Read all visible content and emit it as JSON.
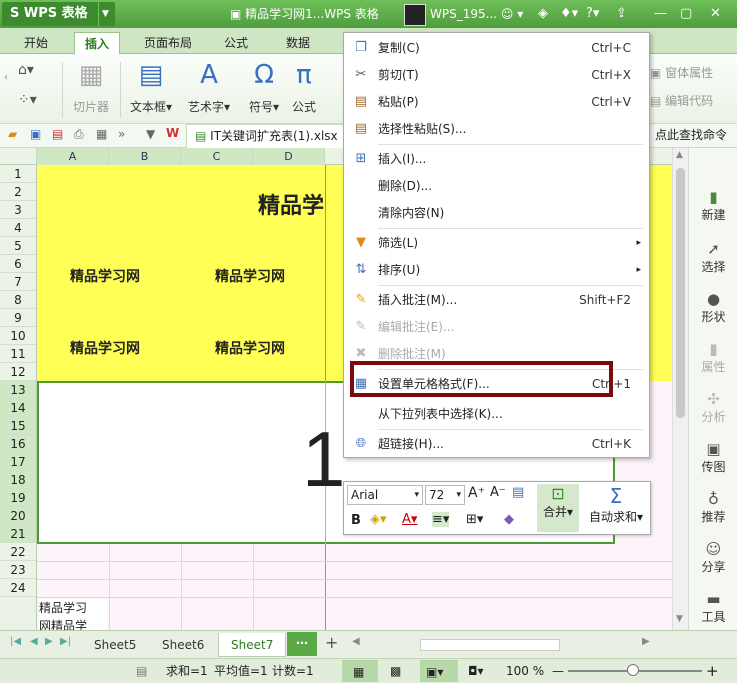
{
  "app": {
    "name": "S WPS 表格",
    "doc_title": "精品学习网1...WPS 表格",
    "user": "WPS_195..."
  },
  "tabs": [
    "开始",
    "插入",
    "页面布局",
    "公式",
    "数据"
  ],
  "active_tab": "插入",
  "ribbon": {
    "slicer": "切片器",
    "textbox": "文本框",
    "wordart": "艺术字",
    "symbol": "符号",
    "formula": "公式",
    "window_props": "窗体属性",
    "edit_code": "编辑代码"
  },
  "file_tab": "IT关键词扩充表(1).xlsx *",
  "find_command": "点此查找命令",
  "columns": [
    "A",
    "B",
    "C",
    "D"
  ],
  "rows": [
    "1",
    "2",
    "3",
    "4",
    "5",
    "6",
    "7",
    "8",
    "9",
    "10",
    "11",
    "12",
    "13",
    "14",
    "15",
    "16",
    "17",
    "18",
    "19",
    "20",
    "21",
    "22",
    "23",
    "24"
  ],
  "cells": {
    "title": "精品学",
    "c1": "精品学习网",
    "c2": "精品学习网",
    "c3": "精品学习网",
    "c4": "精品学习网",
    "big_number": "1",
    "wrap_line1": "精品学习",
    "wrap_line2": "网精品学"
  },
  "context_menu": [
    {
      "icon": "copy-icon",
      "label": "复制(C)",
      "shortcut": "Ctrl+C"
    },
    {
      "icon": "cut-icon",
      "label": "剪切(T)",
      "shortcut": "Ctrl+X"
    },
    {
      "icon": "paste-icon",
      "label": "粘贴(P)",
      "shortcut": "Ctrl+V"
    },
    {
      "icon": "paste-special-icon",
      "label": "选择性粘贴(S)...",
      "shortcut": ""
    },
    {
      "icon": "insert-icon",
      "label": "插入(I)...",
      "shortcut": ""
    },
    {
      "icon": "",
      "label": "删除(D)...",
      "shortcut": ""
    },
    {
      "icon": "",
      "label": "清除内容(N)",
      "shortcut": ""
    },
    {
      "icon": "filter-icon",
      "label": "筛选(L)",
      "shortcut": ""
    },
    {
      "icon": "sort-icon",
      "label": "排序(U)",
      "shortcut": ""
    },
    {
      "icon": "comment-icon",
      "label": "插入批注(M)...",
      "shortcut": "Shift+F2"
    },
    {
      "icon": "edit-comment-icon",
      "label": "编辑批注(E)...",
      "shortcut": ""
    },
    {
      "icon": "delete-comment-icon",
      "label": "删除批注(M)",
      "shortcut": ""
    },
    {
      "icon": "format-cells-icon",
      "label": "设置单元格格式(F)...",
      "shortcut": "Ctrl+1"
    },
    {
      "icon": "",
      "label": "从下拉列表中选择(K)...",
      "shortcut": ""
    },
    {
      "icon": "hyperlink-icon",
      "label": "超链接(H)...",
      "shortcut": "Ctrl+K"
    }
  ],
  "mini_toolbar": {
    "font": "Arial",
    "size": "72",
    "merge": "合并",
    "autosum": "自动求和"
  },
  "right_panel": [
    "新建",
    "选择",
    "形状",
    "属性",
    "分析",
    "传图",
    "推荐",
    "分享",
    "工具"
  ],
  "sheets": [
    "Sheet5",
    "Sheet6",
    "Sheet7"
  ],
  "active_sheet": "Sheet7",
  "status": {
    "sum": "求和=1",
    "avg": "平均值=1",
    "count": "计数=1",
    "zoom": "100 %"
  }
}
